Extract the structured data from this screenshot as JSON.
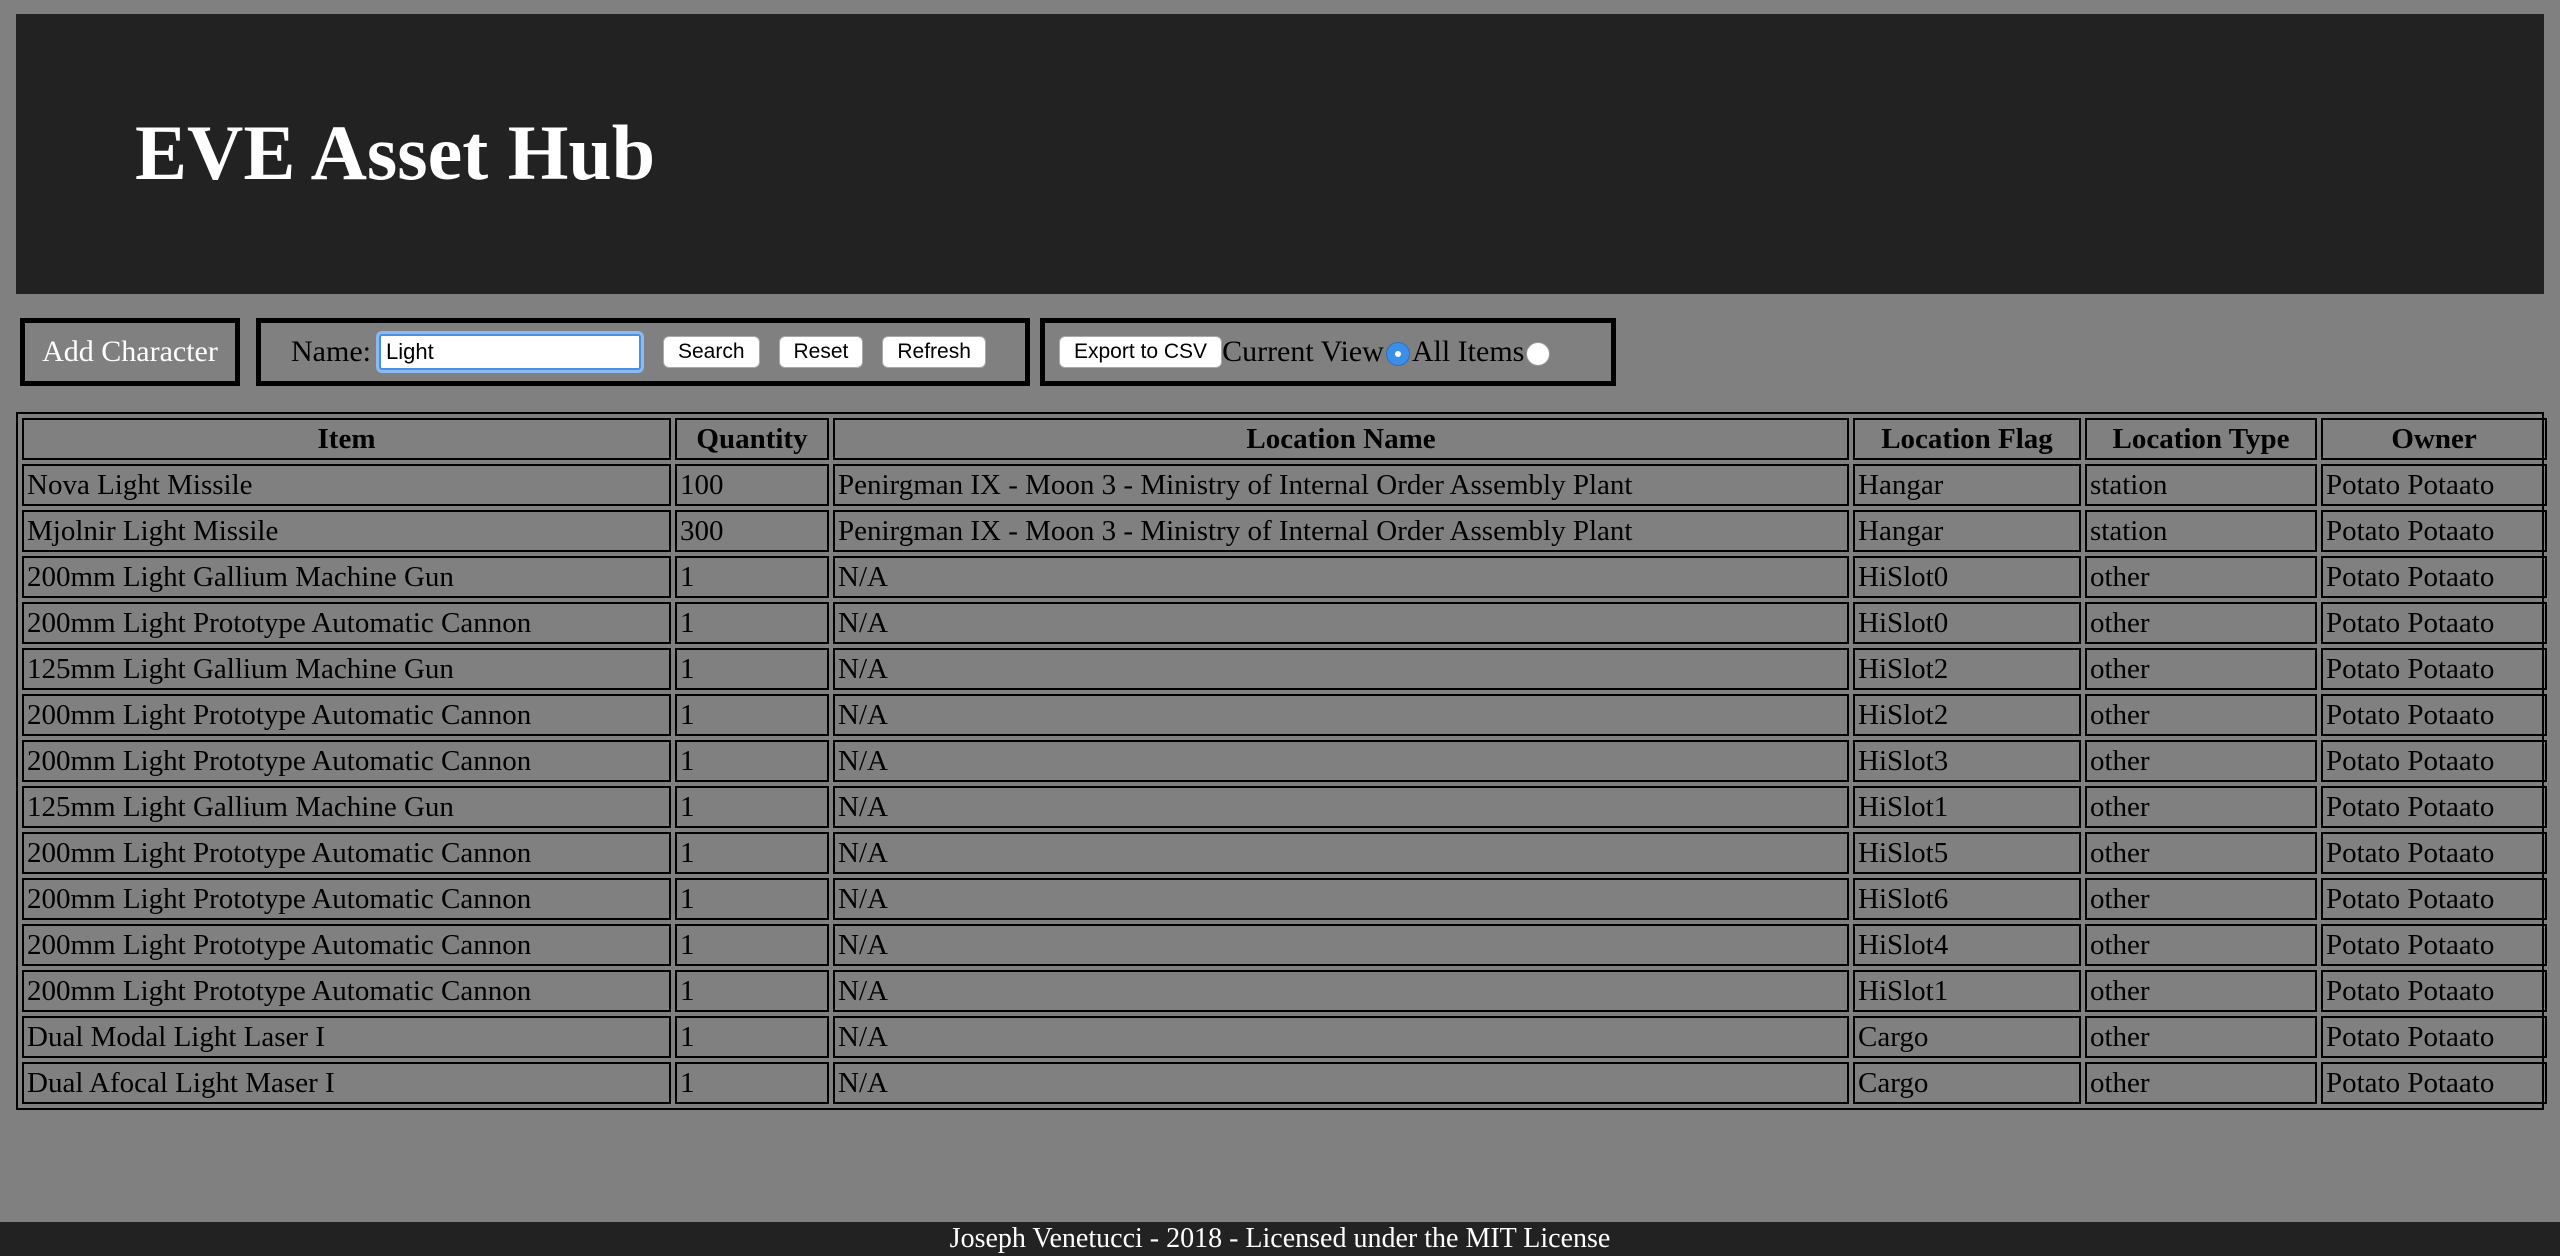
{
  "header": {
    "title": "EVE Asset Hub"
  },
  "toolbar": {
    "add_character_label": "Add Character",
    "name_label": "Name:",
    "search_value": "Light",
    "search_label": "Search",
    "reset_label": "Reset",
    "refresh_label": "Refresh",
    "export_label": "Export to CSV",
    "current_view_label": "Current View",
    "all_items_label": "All Items",
    "selected_view": "Current View"
  },
  "table": {
    "columns": [
      "Item",
      "Quantity",
      "Location Name",
      "Location Flag",
      "Location Type",
      "Owner"
    ],
    "rows": [
      [
        "Nova Light Missile",
        "100",
        "Penirgman IX - Moon 3 - Ministry of Internal Order Assembly Plant",
        "Hangar",
        "station",
        "Potato Potaato"
      ],
      [
        "Mjolnir Light Missile",
        "300",
        "Penirgman IX - Moon 3 - Ministry of Internal Order Assembly Plant",
        "Hangar",
        "station",
        "Potato Potaato"
      ],
      [
        "200mm Light Gallium Machine Gun",
        "1",
        "N/A",
        "HiSlot0",
        "other",
        "Potato Potaato"
      ],
      [
        "200mm Light Prototype Automatic Cannon",
        "1",
        "N/A",
        "HiSlot0",
        "other",
        "Potato Potaato"
      ],
      [
        "125mm Light Gallium Machine Gun",
        "1",
        "N/A",
        "HiSlot2",
        "other",
        "Potato Potaato"
      ],
      [
        "200mm Light Prototype Automatic Cannon",
        "1",
        "N/A",
        "HiSlot2",
        "other",
        "Potato Potaato"
      ],
      [
        "200mm Light Prototype Automatic Cannon",
        "1",
        "N/A",
        "HiSlot3",
        "other",
        "Potato Potaato"
      ],
      [
        "125mm Light Gallium Machine Gun",
        "1",
        "N/A",
        "HiSlot1",
        "other",
        "Potato Potaato"
      ],
      [
        "200mm Light Prototype Automatic Cannon",
        "1",
        "N/A",
        "HiSlot5",
        "other",
        "Potato Potaato"
      ],
      [
        "200mm Light Prototype Automatic Cannon",
        "1",
        "N/A",
        "HiSlot6",
        "other",
        "Potato Potaato"
      ],
      [
        "200mm Light Prototype Automatic Cannon",
        "1",
        "N/A",
        "HiSlot4",
        "other",
        "Potato Potaato"
      ],
      [
        "200mm Light Prototype Automatic Cannon",
        "1",
        "N/A",
        "HiSlot1",
        "other",
        "Potato Potaato"
      ],
      [
        "Dual Modal Light Laser I",
        "1",
        "N/A",
        "Cargo",
        "other",
        "Potato Potaato"
      ],
      [
        "Dual Afocal Light Maser I",
        "1",
        "N/A",
        "Cargo",
        "other",
        "Potato Potaato"
      ]
    ]
  },
  "footer": {
    "text": "Joseph Venetucci - 2018 - Licensed under the MIT License"
  },
  "colors": {
    "background": "#808080",
    "header_bg": "#222222",
    "footer_bg": "#222222",
    "radio_checked": "#3b8fe8"
  }
}
